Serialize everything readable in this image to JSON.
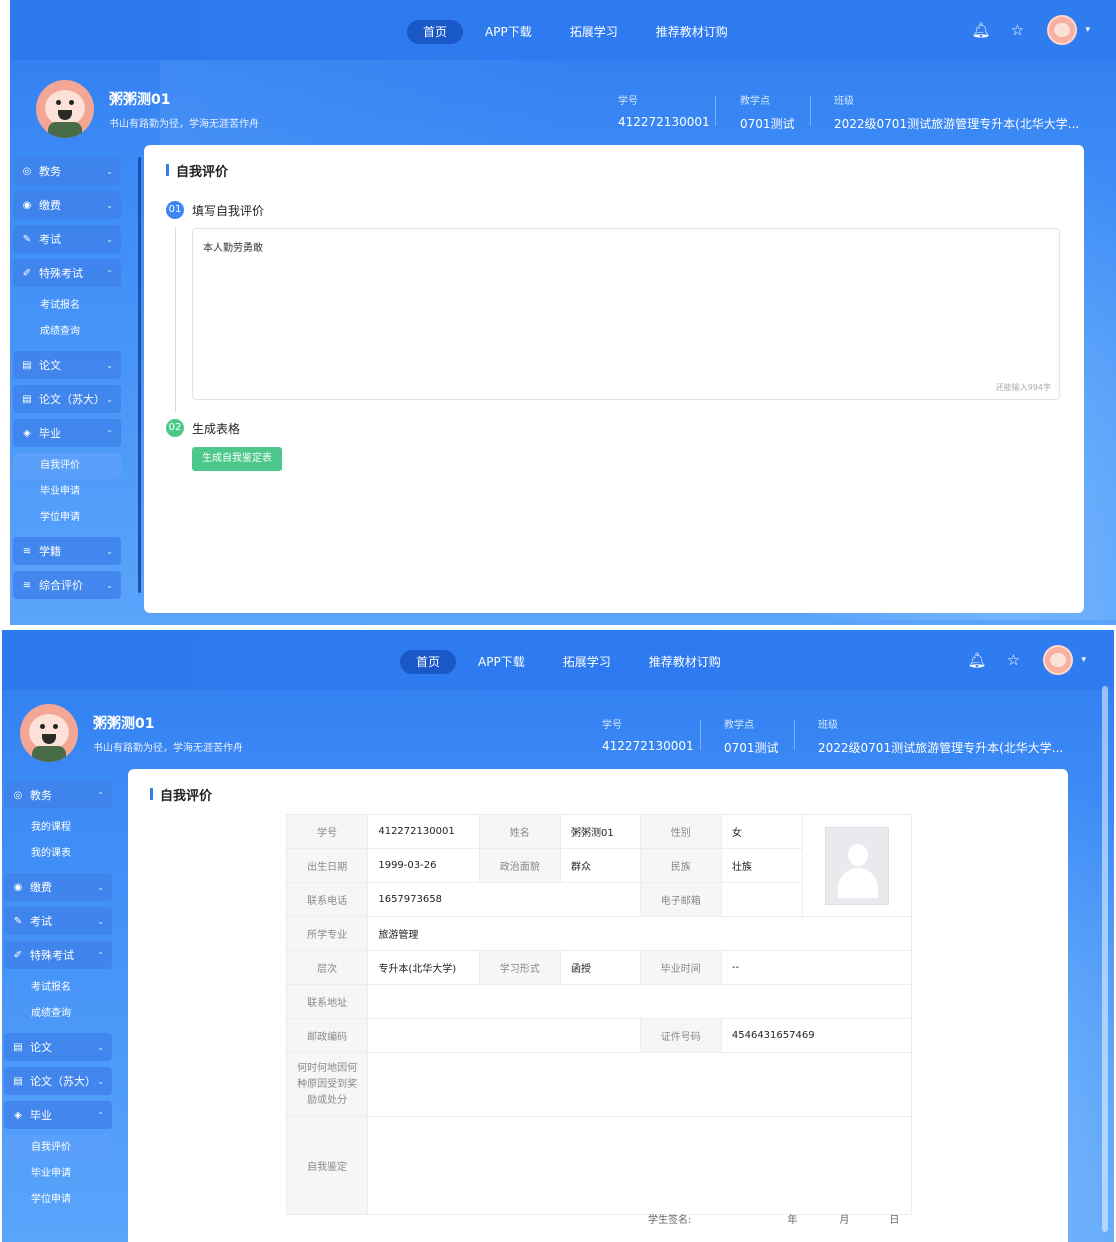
{
  "nav": {
    "items": [
      "首页",
      "APP下载",
      "拓展学习",
      "推荐教材订购"
    ],
    "active_index": 0
  },
  "user": {
    "name": "粥粥测01",
    "motto": "书山有路勤为径，学海无涯苦作舟"
  },
  "info": {
    "student_id_label": "学号",
    "student_id": "412272130001",
    "site_label": "教学点",
    "site": "0701测试",
    "class_label": "班级",
    "class": "2022级0701测试旅游管理专升本(北华大学..."
  },
  "sidebar1": [
    {
      "label": "教务",
      "icon": "target-icon",
      "chev": "⌄"
    },
    {
      "label": "缴费",
      "icon": "coin-icon",
      "chev": "⌄"
    },
    {
      "label": "考试",
      "icon": "pen-icon",
      "chev": "⌄"
    },
    {
      "label": "特殊考试",
      "icon": "edit-icon",
      "chev": "⌃"
    },
    {
      "label": "论文",
      "icon": "doc-icon",
      "chev": "⌄"
    },
    {
      "label": "论文（苏大）",
      "icon": "doc-icon",
      "chev": "⌄"
    },
    {
      "label": "毕业",
      "icon": "cap-icon",
      "chev": "⌃"
    },
    {
      "label": "学籍",
      "icon": "layers-icon",
      "chev": "⌄"
    },
    {
      "label": "综合评价",
      "icon": "layers-icon",
      "chev": "⌄"
    }
  ],
  "special_exam_subs": [
    "考试报名",
    "成绩查询"
  ],
  "graduate_subs": [
    "自我评价",
    "毕业申请",
    "学位申请"
  ],
  "academic_subs": [
    "我的课程",
    "我的课表"
  ],
  "page_title": "自我评价",
  "steps": {
    "step1_num": "01",
    "step1_label": "填写自我评价",
    "content": "本人勤劳勇敢",
    "counter": "还能输入994字",
    "step2_num": "02",
    "step2_label": "生成表格",
    "button": "生成自我鉴定表"
  },
  "form": {
    "student_id_k": "学号",
    "student_id_v": "412272130001",
    "name_k": "姓名",
    "name_v": "粥粥测01",
    "gender_k": "性别",
    "gender_v": "女",
    "birth_k": "出生日期",
    "birth_v": "1999-03-26",
    "politics_k": "政治面貌",
    "politics_v": "群众",
    "ethnic_k": "民族",
    "ethnic_v": "壮族",
    "phone_k": "联系电话",
    "phone_v": "1657973658",
    "email_k": "电子邮箱",
    "email_v": "",
    "major_k": "所学专业",
    "major_v": "旅游管理",
    "level_k": "层次",
    "level_v": "专升本(北华大学)",
    "mode_k": "学习形式",
    "mode_v": "函授",
    "grad_k": "毕业时间",
    "grad_v": "--",
    "address_k": "联系地址",
    "address_v": "",
    "zip_k": "邮政编码",
    "zip_v": "",
    "idno_k": "证件号码",
    "idno_v": "4546431657469",
    "award_k": "何时何地因何种原因受到奖励或处分",
    "self_k": "自我鉴定",
    "sign_label": "学生签名:",
    "year": "年",
    "month": "月",
    "day": "日"
  }
}
